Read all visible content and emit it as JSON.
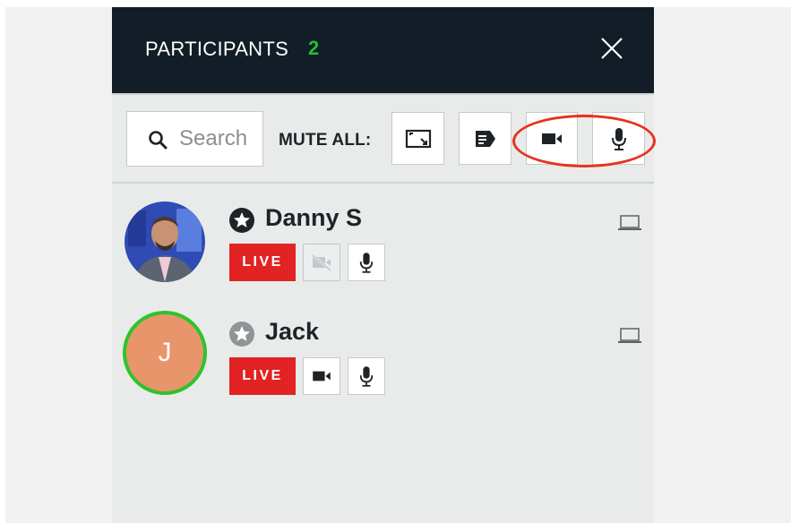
{
  "header": {
    "title": "PARTICIPANTS",
    "count": "2"
  },
  "toolbar": {
    "search_placeholder": "Search",
    "mute_all_label": "MUTE ALL:"
  },
  "participants": [
    {
      "name": "Danny S",
      "role": "host",
      "live_label": "LIVE",
      "video": "off",
      "audio": "on",
      "device": "laptop"
    },
    {
      "name": "Jack",
      "role": "participant",
      "initial": "J",
      "live_label": "LIVE",
      "video": "on",
      "audio": "on",
      "device": "laptop"
    }
  ],
  "colors": {
    "header_bg": "#131d27",
    "count_green": "#22c02d",
    "live_red": "#e12323",
    "highlight_ring": "#e8321c",
    "avatar_orange": "#e8956b",
    "speaking_ring": "#2fc32a"
  }
}
